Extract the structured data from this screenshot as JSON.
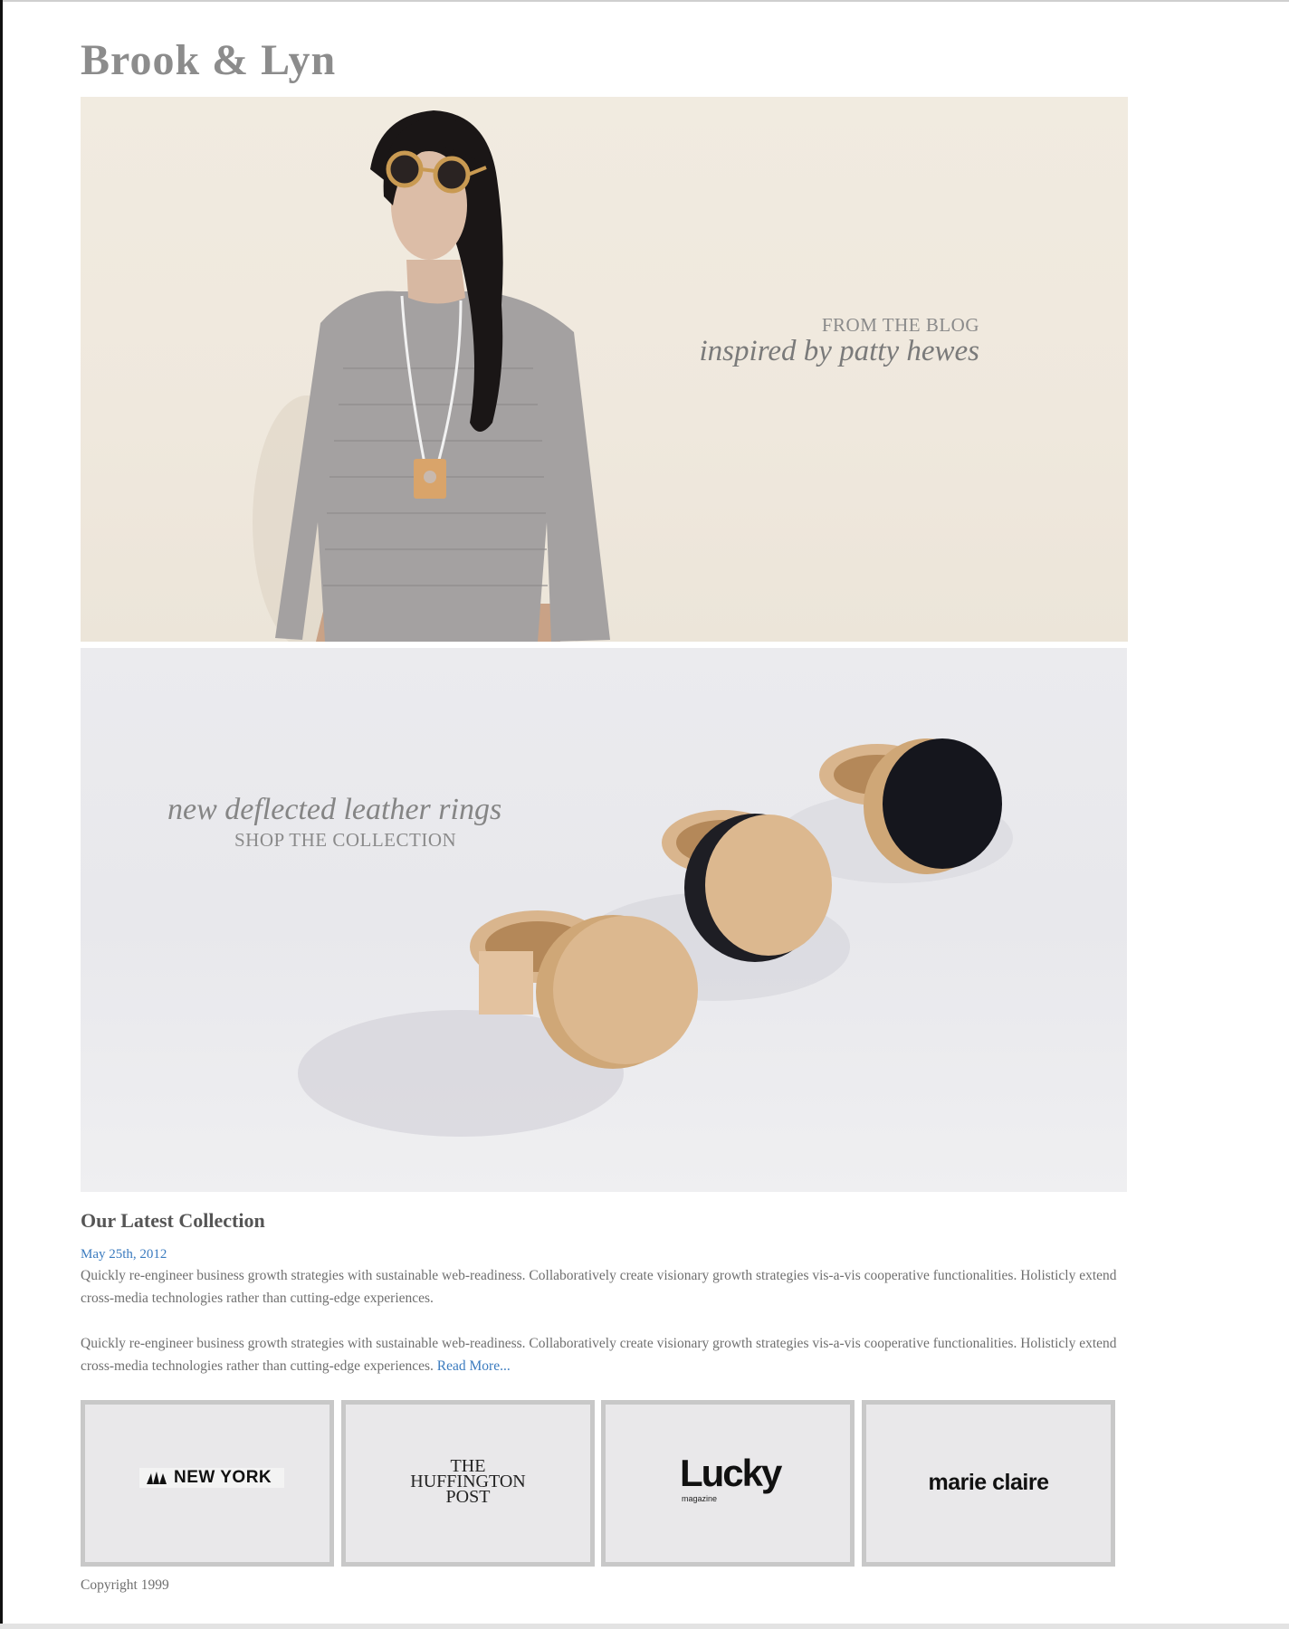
{
  "site": {
    "brand": "Brook & Lyn"
  },
  "hero_blog": {
    "kicker": "FROM THE BLOG",
    "tagline": "inspired by patty hewes",
    "background_color": "#efe8dd"
  },
  "hero_shop": {
    "tagline": "new deflected leather rings",
    "kicker": "SHOP THE COLLECTION",
    "background_color": "#eaeaed"
  },
  "post": {
    "title": "Our Latest Collection",
    "date": "May 25th, 2012",
    "paragraph_1": "Quickly re-engineer business growth strategies with sustainable web-readiness. Collaboratively create visionary growth strategies vis-a-vis cooperative functionalities. Holisticly extend cross-media technologies rather than cutting-edge experiences.",
    "paragraph_2": "Quickly re-engineer business growth strategies with sustainable web-readiness. Collaboratively create visionary growth strategies vis-a-vis cooperative functionalities. Holisticly extend cross-media technologies rather than cutting-edge experiences.",
    "read_more": "Read More...",
    "link_color": "#3b7bbf"
  },
  "press": {
    "ny": "NEW YORK",
    "huff_line1": "THE",
    "huff_line2": "HUFFINGTON",
    "huff_line3": "POST",
    "lucky": "Lucky",
    "lucky_sub": "magazine",
    "marie_claire": "marie claire"
  },
  "footer": {
    "copyright": "Copyright 1999"
  }
}
